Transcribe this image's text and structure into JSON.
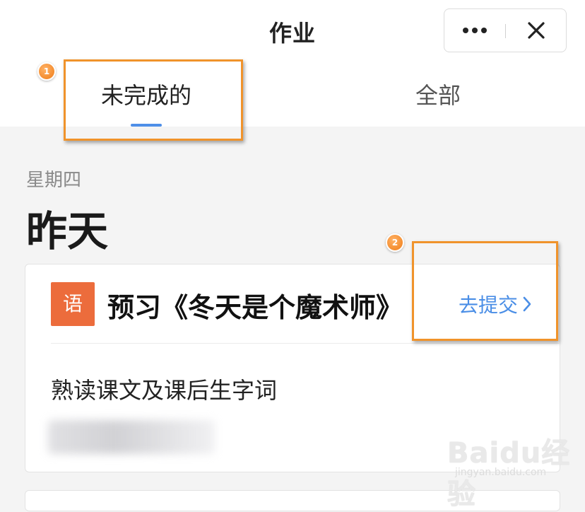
{
  "header": {
    "title": "作业"
  },
  "tabs": [
    {
      "label": "未完成的",
      "active": true
    },
    {
      "label": "全部",
      "active": false
    }
  ],
  "annotations": {
    "step1": "1",
    "step2": "2"
  },
  "section": {
    "weekday": "星期四",
    "day": "昨天"
  },
  "assignment": {
    "subject_badge": "语",
    "title": "预习《冬天是个魔术师》",
    "action": "去提交",
    "description": "熟读课文及课后生字词"
  },
  "watermark": {
    "brand": "Baidu经验",
    "url": "jingyan.baidu.com"
  },
  "colors": {
    "accent": "#4a8ee6",
    "badge": "#ec6c3c",
    "highlight": "#f0932b"
  }
}
